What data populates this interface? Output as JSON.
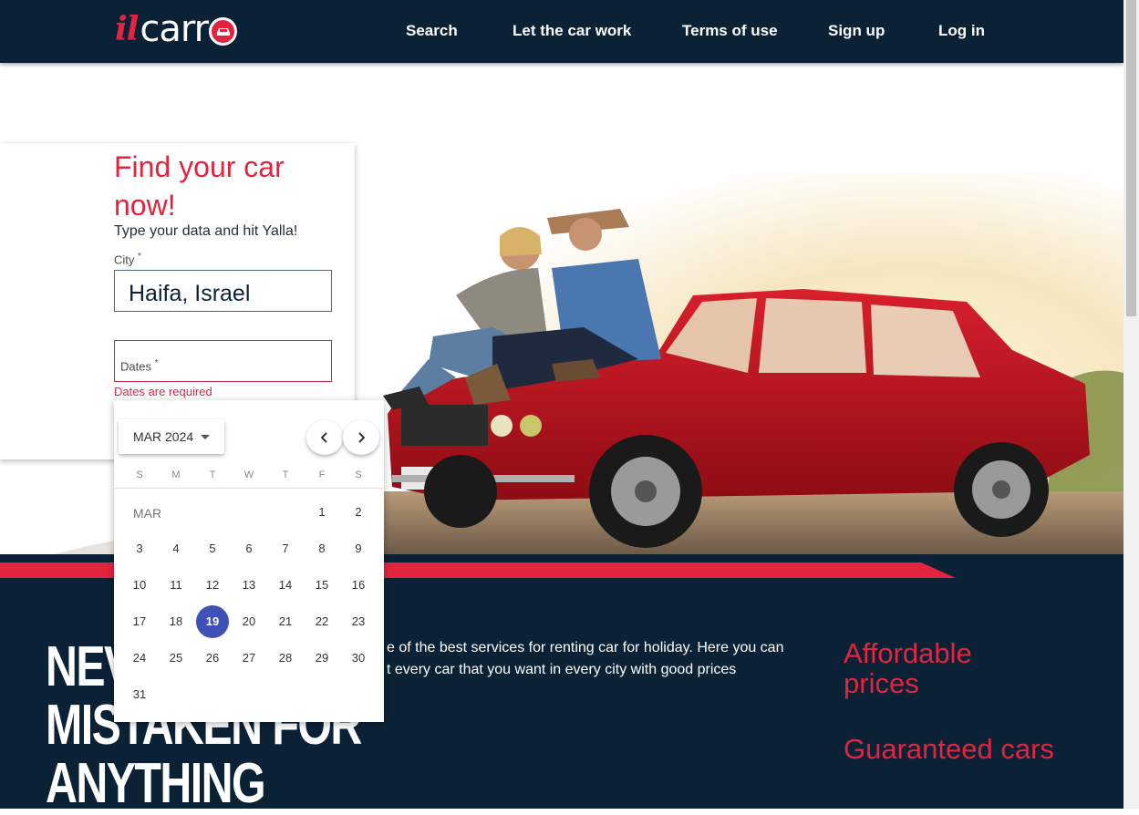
{
  "header": {
    "logo": {
      "il": "il",
      "carr": "carr"
    },
    "nav": [
      {
        "label": "Search"
      },
      {
        "label": "Let the car work"
      },
      {
        "label": "Terms of use"
      },
      {
        "label": "Sign up"
      },
      {
        "label": "Log in"
      }
    ]
  },
  "form": {
    "title": "Find your car now!",
    "subtitle": "Type your data and hit Yalla!",
    "city_label": "City",
    "city_value": "Haifa, Israel",
    "dates_label": "Dates",
    "required_mark": "*",
    "dates_error": "Dates are required"
  },
  "datepicker": {
    "period": "MAR 2024",
    "weekdays": [
      "S",
      "M",
      "T",
      "W",
      "T",
      "F",
      "S"
    ],
    "month_label": "MAR",
    "days": [
      "1",
      "2",
      "3",
      "4",
      "5",
      "6",
      "7",
      "8",
      "9",
      "10",
      "11",
      "12",
      "13",
      "14",
      "15",
      "16",
      "17",
      "18",
      "19",
      "20",
      "21",
      "22",
      "23",
      "24",
      "25",
      "26",
      "27",
      "28",
      "29",
      "30",
      "31"
    ],
    "selected_day": "19",
    "accent": "#3f51b5"
  },
  "band": {
    "slogan": [
      "NEVER",
      "MISTAKEN FOR",
      "ANYTHING"
    ],
    "about_line1": "e of the best services for renting car for holiday. Here you can",
    "about_line2": "t every car that you want in every city with good prices",
    "features": [
      "Affordable prices",
      "Guaranteed cars"
    ]
  },
  "colors": {
    "brand_red": "#e2243f",
    "navy": "#0b2236"
  }
}
